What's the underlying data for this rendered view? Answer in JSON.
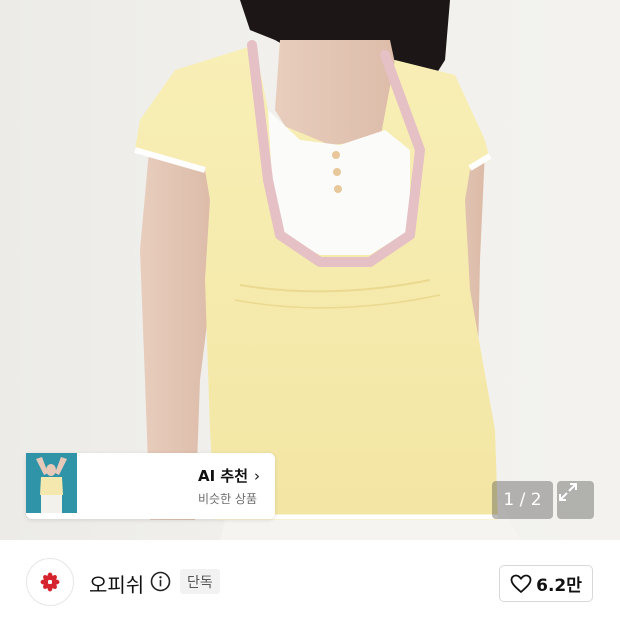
{
  "gallery": {
    "pager_text": "1 / 2",
    "ai_recommend": {
      "title": "AI 추천",
      "subtitle": "비슷한 상품",
      "thumbnails": [
        "thumb-1",
        "thumb-2",
        "thumb-3"
      ]
    }
  },
  "brand": {
    "name": "오피쉬",
    "badge": "단독",
    "like_count": "6.2만"
  },
  "colors": {
    "shirt_yellow": "#f7ecae",
    "trim_pink": "#e5c0c4",
    "brand_red": "#d6242f"
  }
}
